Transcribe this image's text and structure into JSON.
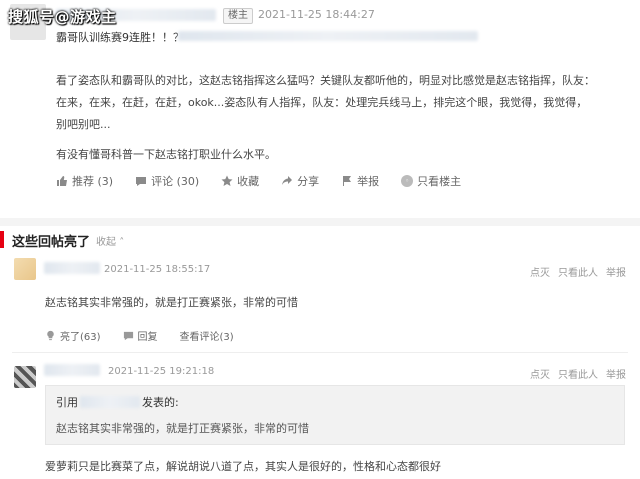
{
  "watermark": "搜狐号@游戏主",
  "post": {
    "op_badge": "楼主",
    "time": "2021-11-25 18:44:27",
    "title": "霸哥队训练赛9连胜！！？",
    "body": [
      "看了姿态队和霸哥队的对比，这赵志铭指挥这么猛吗？关键队友都听他的，明显对比感觉是赵志铭指挥，队友：在来，在来，在赶，在赶，okok...姿态队有人指挥，队友：处理完兵线马上，排完这个眼，我觉得，我觉得，别吧别吧...",
      "有没有懂哥科普一下赵志铭打职业什么水平。"
    ],
    "actions": {
      "recommend": "推荐 (3)",
      "comment": "评论 (30)",
      "favorite": "收藏",
      "share": "分享",
      "report": "举报",
      "only_op": "只看楼主"
    }
  },
  "hot_replies": {
    "title": "这些回帖亮了",
    "collapse": "收起",
    "replies": [
      {
        "time": "2021-11-25 18:55:17",
        "ops": [
          "点灭",
          "只看此人",
          "举报"
        ],
        "text": "赵志铭其实非常强的，就是打正赛紧张，非常的可惜",
        "actions": {
          "light": "亮了(63)",
          "reply": "回复",
          "view": "查看评论(3)"
        }
      },
      {
        "time": "2021-11-25 19:21:18",
        "ops": [
          "点灭",
          "只看此人",
          "举报"
        ],
        "quote_prefix": "引用",
        "quote_suffix": "发表的:",
        "quote_text": "赵志铭其实非常强的，就是打正赛紧张，非常的可惜",
        "text": "爱萝莉只是比赛菜了点，解说胡说八道了点，其实人是很好的，性格和心态都很好"
      }
    ]
  },
  "colors": {
    "accent": "#e60012",
    "divider": "#f4f4f4",
    "quote_bg": "#f2f2f2"
  }
}
